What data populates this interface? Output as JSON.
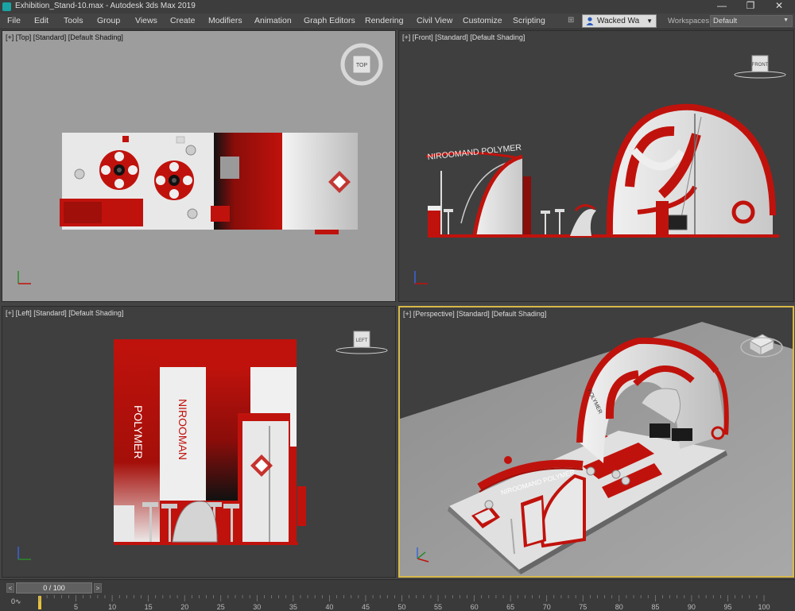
{
  "window": {
    "title": "Exhibition_Stand-10.max - Autodesk 3ds Max 2019",
    "minimize_glyph": "—",
    "restore_glyph": "❐",
    "close_glyph": "✕"
  },
  "menu": {
    "items": [
      "File",
      "Edit",
      "Tools",
      "Group",
      "Views",
      "Create",
      "Modifiers",
      "Animation",
      "Graph Editors",
      "Rendering",
      "Civil View",
      "Customize",
      "Scripting"
    ],
    "signin_label": "Wacked Wa",
    "workspaces_label": "Workspaces:",
    "workspace_value": "Default"
  },
  "viewports": {
    "top": {
      "label": "[+] [Top] [Standard] [Default Shading]",
      "cube_label": "TOP"
    },
    "front": {
      "label": "[+] [Front] [Standard] [Default Shading]",
      "cube_label": "FRONT"
    },
    "left": {
      "label": "[+] [Left] [Standard] [Default Shading]",
      "cube_label": "LEFT"
    },
    "perspective": {
      "label": "[+] [Perspective] [Standard] [Default Shading]"
    }
  },
  "scene_text": {
    "brand": "NIROOMAND POLYMER",
    "wall_word_1": "NIROOMAN",
    "wall_word_2": "POLYMER"
  },
  "timeline": {
    "frame_display": "0 / 100",
    "left_arrow": "<",
    "right_arrow": ">",
    "corner": "0∿",
    "ticks": [
      "5",
      "10",
      "15",
      "20",
      "25",
      "30",
      "35",
      "40",
      "45",
      "50",
      "55",
      "60",
      "65",
      "70",
      "75",
      "80",
      "85",
      "90",
      "95",
      "100"
    ]
  },
  "colors": {
    "brand_red": "#c0120c",
    "active_viewport_border": "#d7b94a",
    "key_marker": "#e8c23c"
  }
}
